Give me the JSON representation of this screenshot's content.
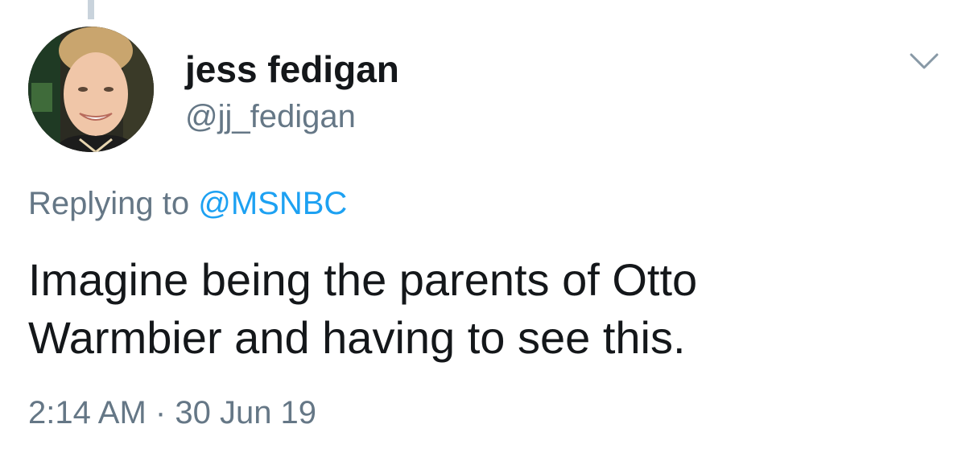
{
  "tweet": {
    "author": {
      "display_name": "jess fedigan",
      "handle": "@jj_fedigan"
    },
    "reply_context": {
      "prefix": "Replying to",
      "mention": "@MSNBC"
    },
    "text_lines": [
      "Imagine being the parents of Otto",
      "Warmbier and having to see this."
    ],
    "time": "2:14 AM",
    "separator": "·",
    "date": "30 Jun 19"
  },
  "icons": {
    "menu": "chevron-down-icon"
  },
  "colors": {
    "name": "#14171a",
    "secondary": "#657786",
    "link": "#1da1f2",
    "thread_line": "#c9d3dc"
  }
}
